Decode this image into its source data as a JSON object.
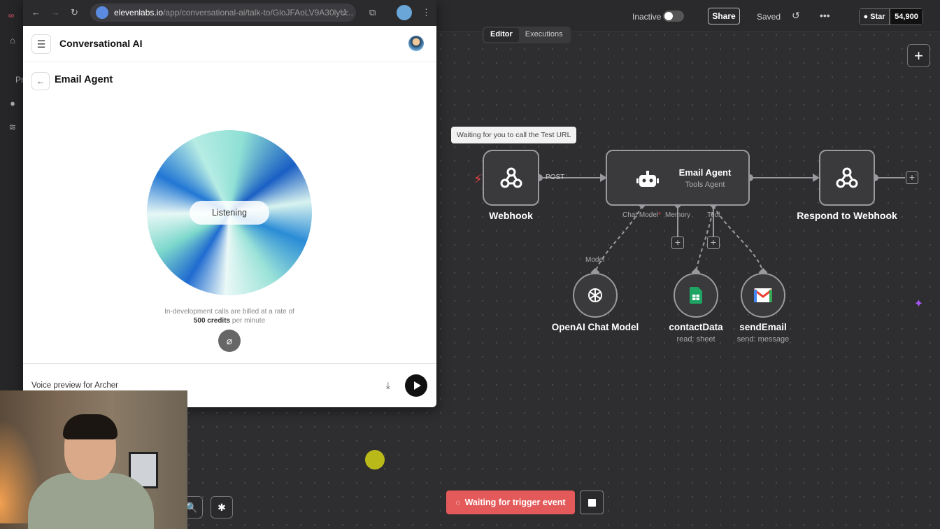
{
  "n8n": {
    "topbar": {
      "inactive_label": "Inactive",
      "share_label": "Share",
      "saved_label": "Saved",
      "star_label": "Star",
      "star_count": "54,900"
    },
    "tabs": [
      "Editor",
      "Executions"
    ],
    "tooltip": "Waiting for you to call the Test URL",
    "nodes": {
      "webhook": {
        "label": "Webhook",
        "port": "POST"
      },
      "email_agent": {
        "label": "Email Agent",
        "sub": "Tools Agent",
        "ports": [
          "Chat Model",
          "Memory",
          "Tool"
        ]
      },
      "respond": {
        "label": "Respond to Webhook"
      },
      "openai": {
        "label": "OpenAI Chat Model",
        "port": "Model"
      },
      "contact": {
        "label": "contactData",
        "sub": "read: sheet"
      },
      "send": {
        "label": "sendEmail",
        "sub": "send: message"
      }
    },
    "required_mark": "*",
    "trigger_label": "Waiting for trigger event",
    "left_rail_partial": "Pr"
  },
  "browser": {
    "url_domain": "elevenlabs.io",
    "url_path": "/app/conversational-ai/talk-to/GloJFAoLV9A30lyU...",
    "app_title": "Conversational AI",
    "agent_title": "Email Agent",
    "listening_label": "Listening",
    "billing_pre": "In-development calls are billed at a rate of",
    "billing_bold": "500 credits",
    "billing_post": "per minute",
    "voice_preview": "Voice preview for Archer"
  },
  "colors": {
    "trigger": "#e45a5a",
    "canvas": "#2e2e30",
    "accent_purple": "#a855f7"
  }
}
